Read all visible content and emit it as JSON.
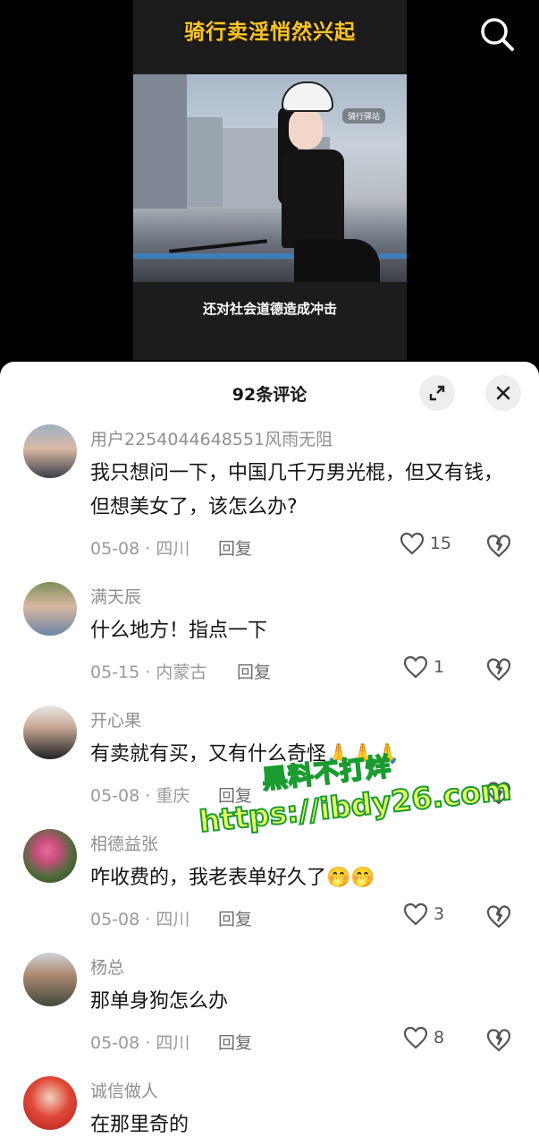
{
  "video": {
    "title": "骑行卖淫悄然兴起",
    "subtitle": "还对社会道德造成冲击",
    "tag": "骑行驿站"
  },
  "icons": {
    "search": "search-icon",
    "expand": "expand-icon",
    "close": "close-icon",
    "like": "heart-outline-icon",
    "dislike": "broken-heart-icon"
  },
  "sheet": {
    "title": "92条评论"
  },
  "comments": [
    {
      "user": "用户2254044648551风雨无阻",
      "text": "我只想问一下，中国几千万男光棍，但又有钱，但想美女了，该怎么办?",
      "meta": "05-08 · 四川",
      "reply": "回复",
      "likes": "15"
    },
    {
      "user": "满天辰",
      "text": "什么地方！指点一下",
      "meta": "05-15 · 内蒙古",
      "reply": "回复",
      "likes": "1"
    },
    {
      "user": "开心果",
      "text": "有卖就有买，又有什么奇怪🙏🙏🙏",
      "meta": "05-08 · 重庆",
      "reply": "回复",
      "likes": ""
    },
    {
      "user": "相德益张",
      "text": "咋收费的，我老表单好久了🤭🤭",
      "meta": "05-08 · 四川",
      "reply": "回复",
      "likes": "3"
    },
    {
      "user": "杨总",
      "text": "那单身狗怎么办",
      "meta": "05-08 · 四川",
      "reply": "回复",
      "likes": "8"
    },
    {
      "user": "诚信做人",
      "text": "在那里奇的",
      "meta": "",
      "reply": "",
      "likes": ""
    }
  ],
  "watermark": {
    "line1": "黑料不打烊",
    "line2": "https://ibdy26.com"
  },
  "colors": {
    "title_yellow": "#f7c52b",
    "watermark_green": "#1a9b2f",
    "watermark_yellow": "#e9ff64"
  }
}
